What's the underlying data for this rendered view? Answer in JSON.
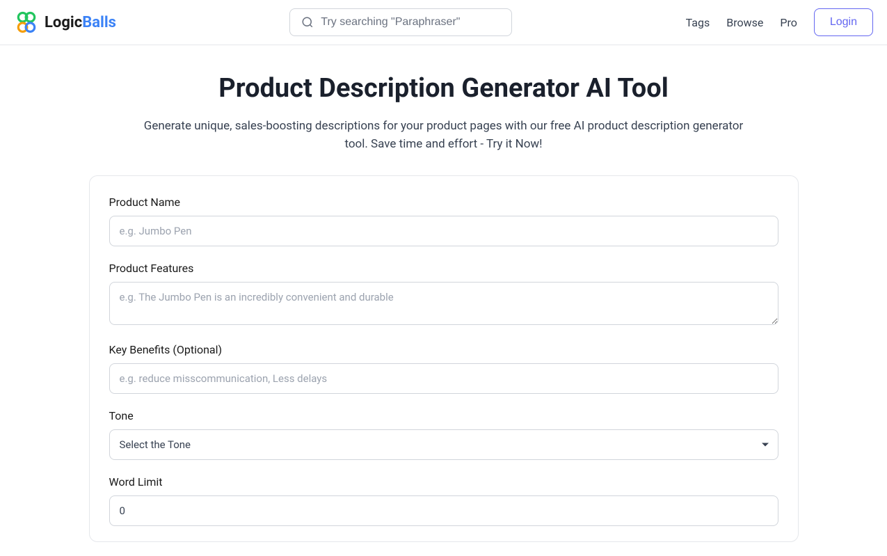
{
  "brand": {
    "name_part1": "Logic",
    "name_part2": "Balls"
  },
  "search": {
    "placeholder": "Try searching \"Paraphraser\""
  },
  "nav": {
    "tags": "Tags",
    "browse": "Browse",
    "pro": "Pro",
    "login": "Login"
  },
  "page": {
    "title": "Product Description Generator AI Tool",
    "subtitle": "Generate unique, sales-boosting descriptions for your product pages with our free AI product description generator tool. Save time and effort - Try it Now!"
  },
  "form": {
    "product_name": {
      "label": "Product Name",
      "placeholder": "e.g. Jumbo Pen"
    },
    "product_features": {
      "label": "Product Features",
      "placeholder": "e.g. The Jumbo Pen is an incredibly convenient and durable"
    },
    "key_benefits": {
      "label": "Key Benefits (Optional)",
      "placeholder": "e.g. reduce misscommunication, Less delays"
    },
    "tone": {
      "label": "Tone",
      "selected": "Select the Tone"
    },
    "word_limit": {
      "label": "Word Limit",
      "value": "0"
    }
  }
}
